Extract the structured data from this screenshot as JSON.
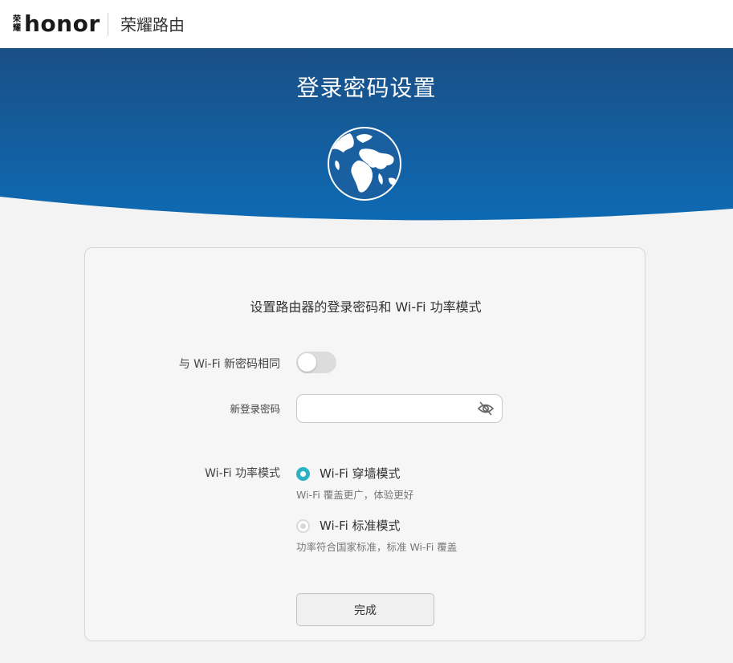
{
  "header": {
    "brand_mark": [
      "荣",
      "耀"
    ],
    "brand_name": "honor",
    "product": "荣耀路由"
  },
  "hero": {
    "title": "登录密码设置"
  },
  "card": {
    "subtitle": "设置路由器的登录密码和 Wi-Fi 功率模式",
    "same_as_wifi": {
      "label": "与 Wi-Fi 新密码相同",
      "enabled": false
    },
    "new_password": {
      "label": "新登录密码",
      "value": "",
      "placeholder": ""
    },
    "wifi_mode": {
      "label": "Wi-Fi 功率模式",
      "options": [
        {
          "label": "Wi-Fi 穿墙模式",
          "description": "Wi-Fi 覆盖更广，体验更好",
          "selected": true
        },
        {
          "label": "Wi-Fi 标准模式",
          "description": "功率符合国家标准，标准 Wi-Fi 覆盖",
          "selected": false
        }
      ]
    },
    "done_label": "完成"
  },
  "colors": {
    "hero_top": "#1a4f86",
    "hero_bottom": "#0e6ab3",
    "accent": "#2bb3c4",
    "brand_red": "#e60012"
  },
  "icons": {
    "globe": "globe-icon",
    "password_visibility": "eye-off-icon"
  }
}
